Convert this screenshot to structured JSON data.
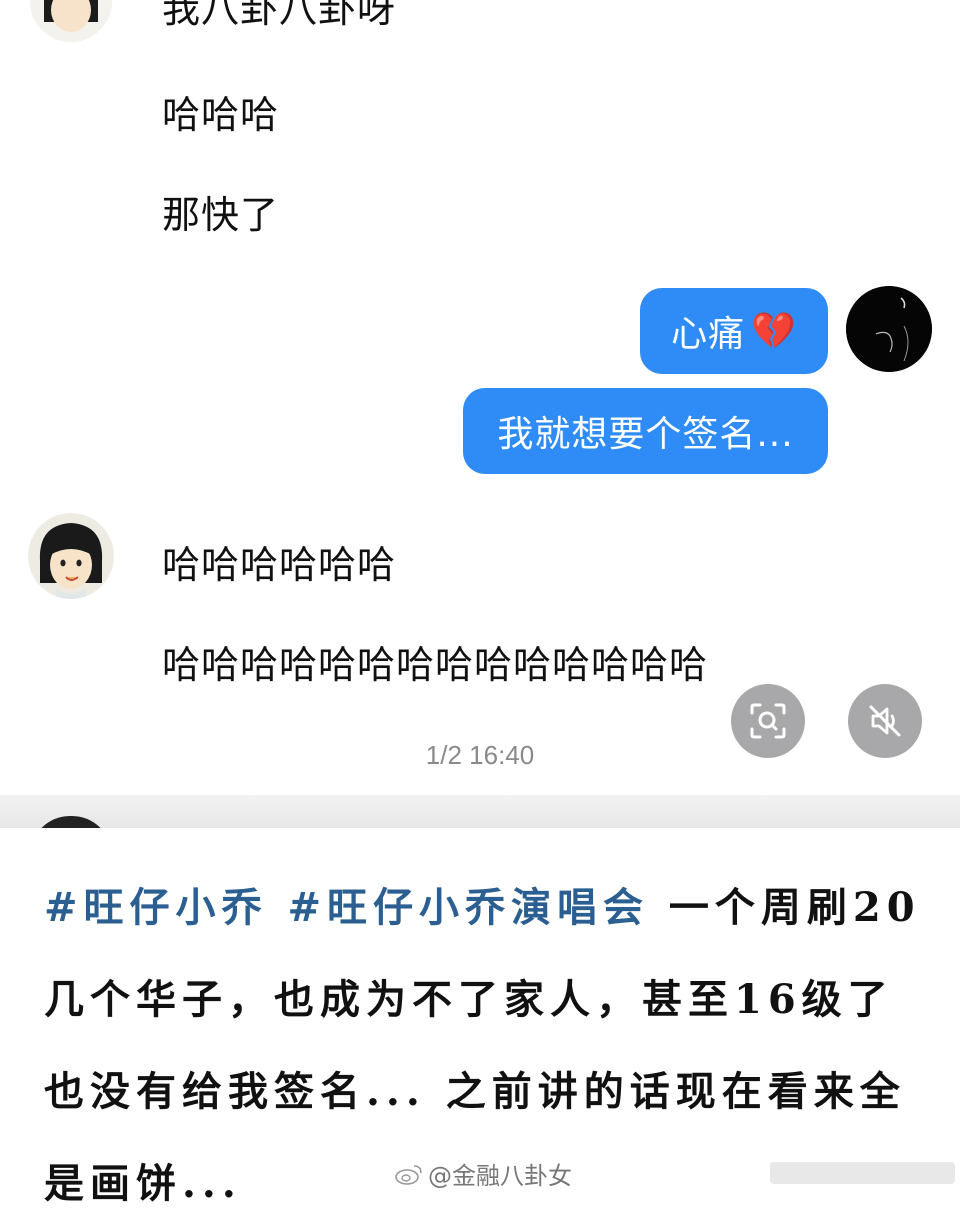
{
  "chat": {
    "messages_top": [
      {
        "text": "我八卦八卦呀"
      },
      {
        "text": "哈哈哈"
      },
      {
        "text": "那快了"
      }
    ],
    "my_messages": [
      {
        "text": "心痛",
        "emoji": "💔"
      },
      {
        "text": "我就想要个签名..."
      }
    ],
    "messages_bottom": [
      {
        "text": "哈哈哈哈哈哈"
      },
      {
        "text": "哈哈哈哈哈哈哈哈哈哈哈哈哈哈"
      }
    ],
    "timestamp": "1/2 16:40",
    "colors": {
      "bubble": "#2f8cf6",
      "fab": "#a8a8aa"
    },
    "icons": [
      "search-icon",
      "mute-icon"
    ]
  },
  "caption": {
    "tags": [
      "#旺仔小乔",
      "#旺仔小乔演唱会"
    ],
    "body": " 一个周刷20几个华子，也成为不了家人，甚至16级了也没有给我签名...   之前讲的话现在看来全是画饼..."
  },
  "watermark": {
    "text": "@金融八卦女"
  }
}
